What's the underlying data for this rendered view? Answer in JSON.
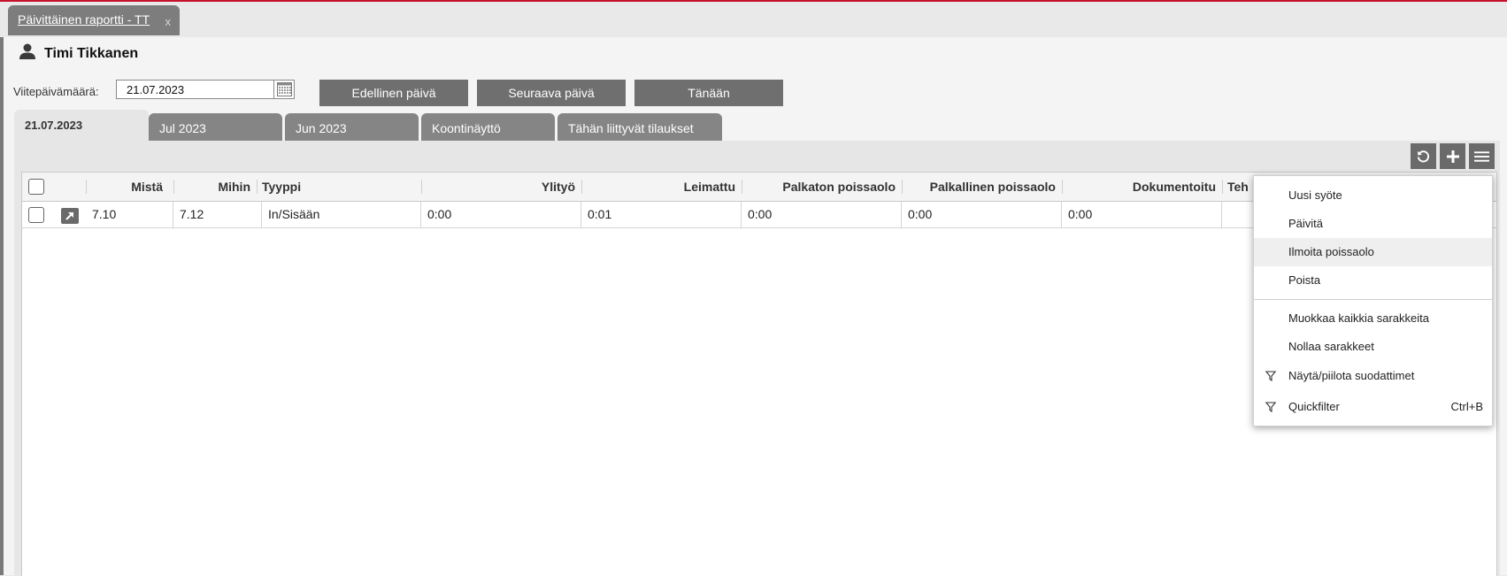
{
  "window_tab": {
    "title": "Päivittäinen raportti - TT",
    "close": "x"
  },
  "user": {
    "name": "Timi Tikkanen"
  },
  "date": {
    "label": "Viitepäivämäärä:",
    "value": "21.07.2023"
  },
  "nav": {
    "prev": "Edellinen päivä",
    "next": "Seuraava päivä",
    "today": "Tänään"
  },
  "tabs": [
    "21.07.2023",
    "Jul 2023",
    "Jun 2023",
    "Koontinäyttö",
    "Tähän liittyvät tilaukset"
  ],
  "grid": {
    "columns": {
      "from": "Mistä",
      "to": "Mihin",
      "type": "Tyyppi",
      "overtime": "Ylityö",
      "stamped": "Leimattu",
      "unpaid": "Palkaton poissaolo",
      "paid": "Palkallinen poissaolo",
      "documented": "Dokumentoitu",
      "partial": "Teh"
    },
    "rows": [
      {
        "from": "7.10",
        "to": "7.12",
        "type": "In/Sisään",
        "overtime": "0:00",
        "stamped": "0:01",
        "unpaid": "0:00",
        "paid": "0:00",
        "documented": "0:00"
      }
    ]
  },
  "menu": {
    "new_entry": "Uusi syöte",
    "refresh": "Päivitä",
    "report_absence": "Ilmoita poissaolo",
    "delete": "Poista",
    "edit_columns": "Muokkaa kaikkia sarakkeita",
    "reset_columns": "Nollaa sarakkeet",
    "toggle_filters": "Näytä/piilota suodattimet",
    "quickfilter": "Quickfilter",
    "quickfilter_shortcut": "Ctrl+B"
  }
}
